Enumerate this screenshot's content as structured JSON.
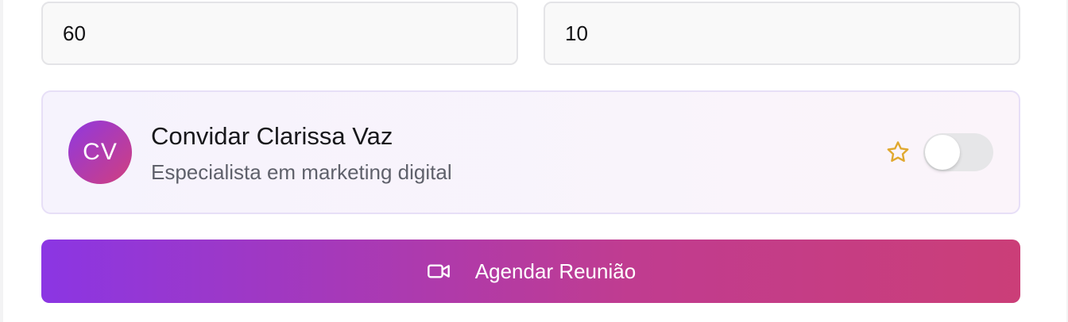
{
  "fields": {
    "left_value": "60",
    "right_value": "10"
  },
  "invite": {
    "avatar_initials": "CV",
    "name": "Convidar Clarissa Vaz",
    "role": "Especialista em marketing digital",
    "favorite_icon": "star-icon",
    "toggle_on": false
  },
  "schedule_button": {
    "icon": "video-camera-icon",
    "label": "Agendar Reunião"
  },
  "colors": {
    "accent_start": "#8b36e3",
    "accent_end": "#cb3e78",
    "star": "#e0a82e"
  }
}
